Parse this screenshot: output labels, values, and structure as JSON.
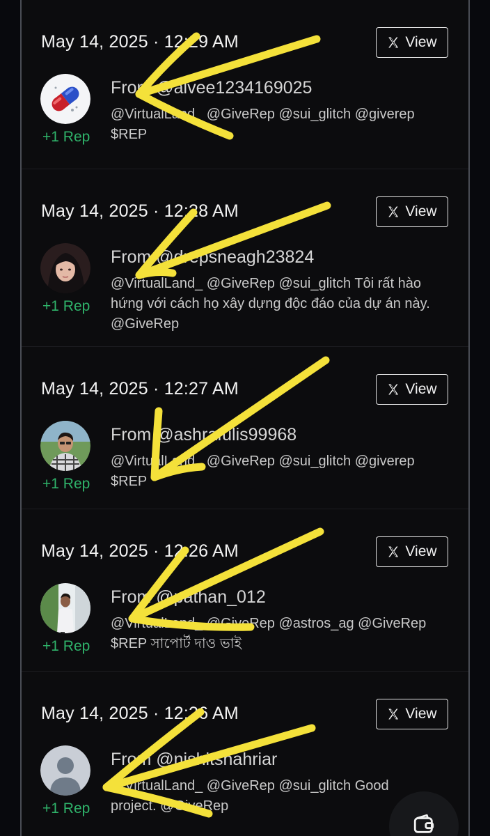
{
  "posts": [
    {
      "date": "May 14, 2025 · 12:29 AM",
      "view_label": "View",
      "from": "From @alvee1234169025",
      "message": "@VirtualLand_ @GiveRep @sui_glitch @giverep $REP",
      "rep": "+1 Rep",
      "avatar_icon": "red-blue-pill-icon"
    },
    {
      "date": "May 14, 2025 · 12:28 AM",
      "view_label": "View",
      "from": "From @drepsneagh23824",
      "message": "@VirtualLand_ @GiveRep @sui_glitch Tôi rất hào hứng với cách họ xây dựng độc đáo của dự án này. @GiveRep",
      "rep": "+1 Rep",
      "avatar_icon": "user-photo-icon"
    },
    {
      "date": "May 14, 2025 · 12:27 AM",
      "view_label": "View",
      "from": "From @ashrafulis99968",
      "message": "@VirtualLand_ @GiveRep @sui_glitch @giverep $REP",
      "rep": "+1 Rep",
      "avatar_icon": "user-photo-icon"
    },
    {
      "date": "May 14, 2025 · 12:26 AM",
      "view_label": "View",
      "from": "From @pathan_012",
      "message": "@VirtualLand_ @GiveRep @astros_ag @GiveRep $REP সাপোর্ট দাও ভাই",
      "rep": "+1 Rep",
      "avatar_icon": "user-photo-icon"
    },
    {
      "date": "May 14, 2025 · 12:26 AM",
      "view_label": "View",
      "from": "From @nishitshahriar",
      "message": "@VirtualLand_ @GiveRep @sui_glitch Good project. @GiveRep",
      "rep": "+1 Rep",
      "avatar_icon": "default-user-icon"
    }
  ],
  "fab_icon": "wallet-icon",
  "colors": {
    "rep_green": "#2fb36a",
    "arrow_yellow": "#f4e13a",
    "background": "#08090d"
  }
}
